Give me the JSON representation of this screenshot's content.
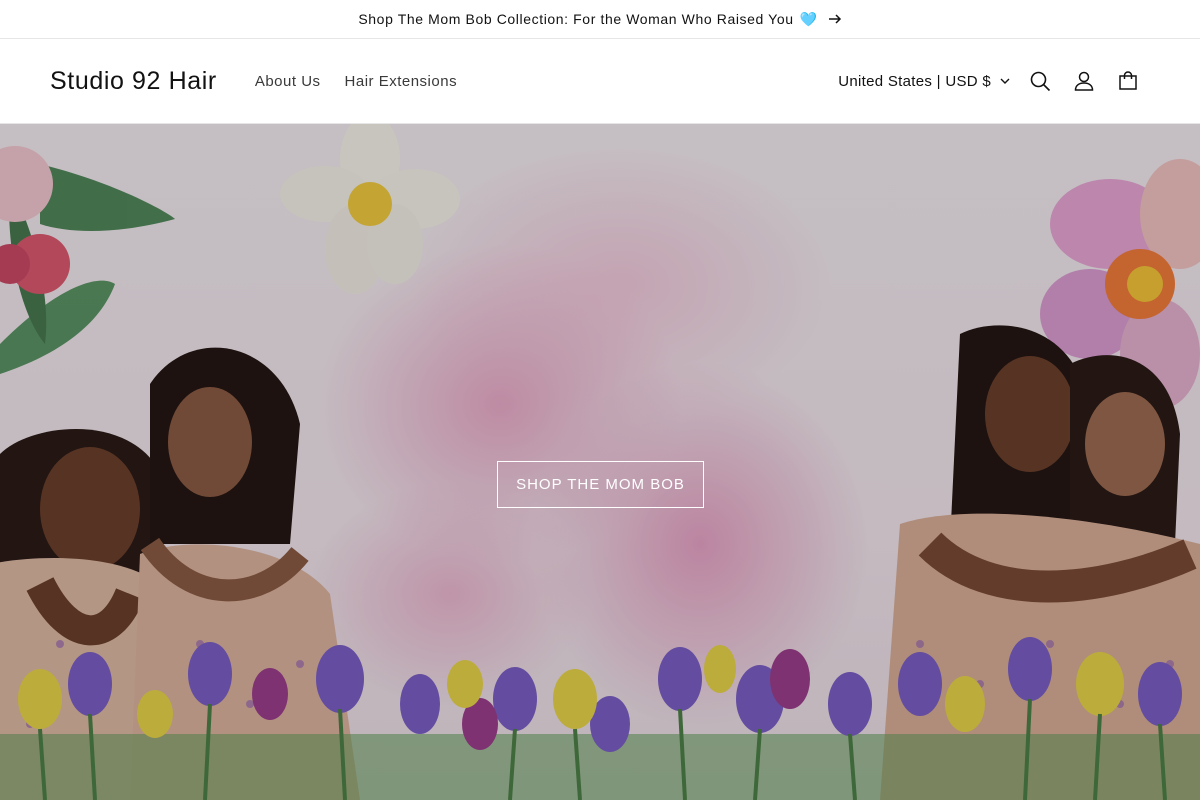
{
  "announcement": {
    "text": "Shop The Mom Bob Collection:  For the Woman Who Raised You",
    "emoji": "🩵",
    "arrow_icon": "arrow-right-icon"
  },
  "header": {
    "logo": "Studio 92 Hair",
    "nav": [
      {
        "label": "About Us"
      },
      {
        "label": "Hair Extensions"
      }
    ],
    "locale": "United States | USD $",
    "icons": [
      "search-icon",
      "account-icon",
      "cart-icon"
    ]
  },
  "hero": {
    "cta_label": "SHOP THE MOM BOB",
    "image_alt": "Women in floral dresses with watercolor flowers"
  },
  "colors": {
    "text": "#121212",
    "border": "#e6e6e6",
    "hero_pink": "#e8aac8",
    "iris_purple": "#6a5bb8",
    "iris_yellow": "#e6d24a"
  }
}
